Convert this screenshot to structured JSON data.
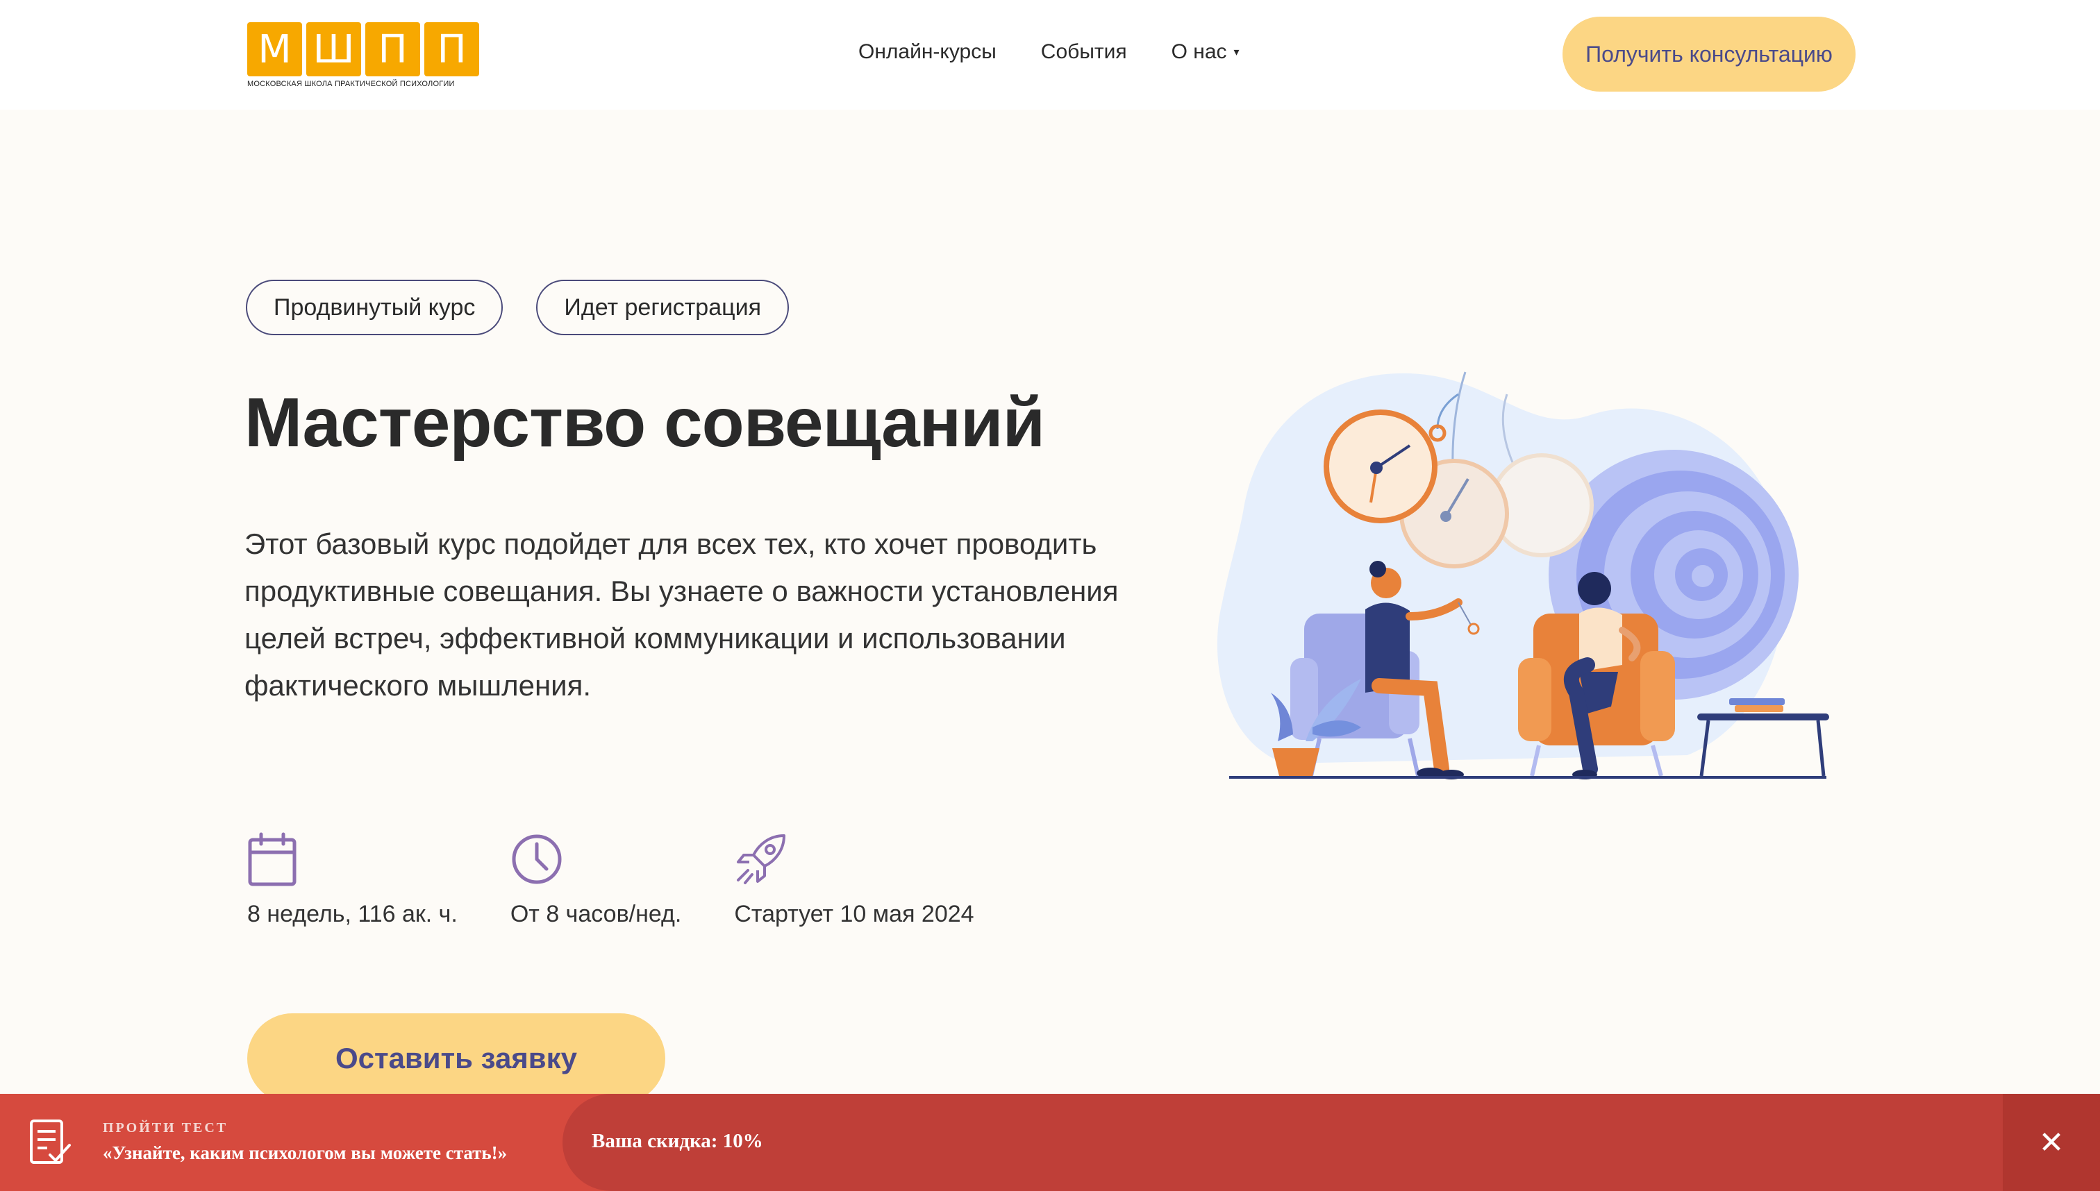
{
  "header": {
    "logo": {
      "letters": [
        "М",
        "Ш",
        "П",
        "П"
      ],
      "caption": "МОСКОВСКАЯ ШКОЛА ПРАКТИЧЕСКОЙ ПСИХОЛОГИИ"
    },
    "nav": [
      {
        "label": "Онлайн-курсы"
      },
      {
        "label": "События"
      },
      {
        "label": "О нас",
        "has_dropdown": true
      }
    ],
    "consult_button": "Получить консультацию"
  },
  "hero": {
    "tags": [
      "Продвинутый курс",
      "Идет регистрация"
    ],
    "title": "Мастерство совещаний",
    "description": "Этот базовый курс подойдет для всех тех, кто хочет проводить продуктивные совещания. Вы узнаете о важности установления целей встреч, эффективной коммуникации и использовании фактического мышления.",
    "meta": [
      {
        "icon": "calendar-icon",
        "text": "8 недель, 116 ак. ч."
      },
      {
        "icon": "clock-icon",
        "text": "От 8 часов/нед."
      },
      {
        "icon": "rocket-icon",
        "text": "Стартует 10 мая 2024"
      }
    ],
    "apply_button": "Оставить заявку"
  },
  "banner": {
    "label": "ПРОЙТИ ТЕСТ",
    "text": "«Узнайте, каким психологом вы можете стать!»",
    "discount": "Ваша скидка: 10%",
    "close_glyph": "✕"
  },
  "colors": {
    "accent_yellow": "#fcd684",
    "logo_orange": "#f7a800",
    "icon_purple": "#8c6fb0",
    "banner_red": "#d64a3e",
    "banner_dark": "#bf3f38"
  }
}
